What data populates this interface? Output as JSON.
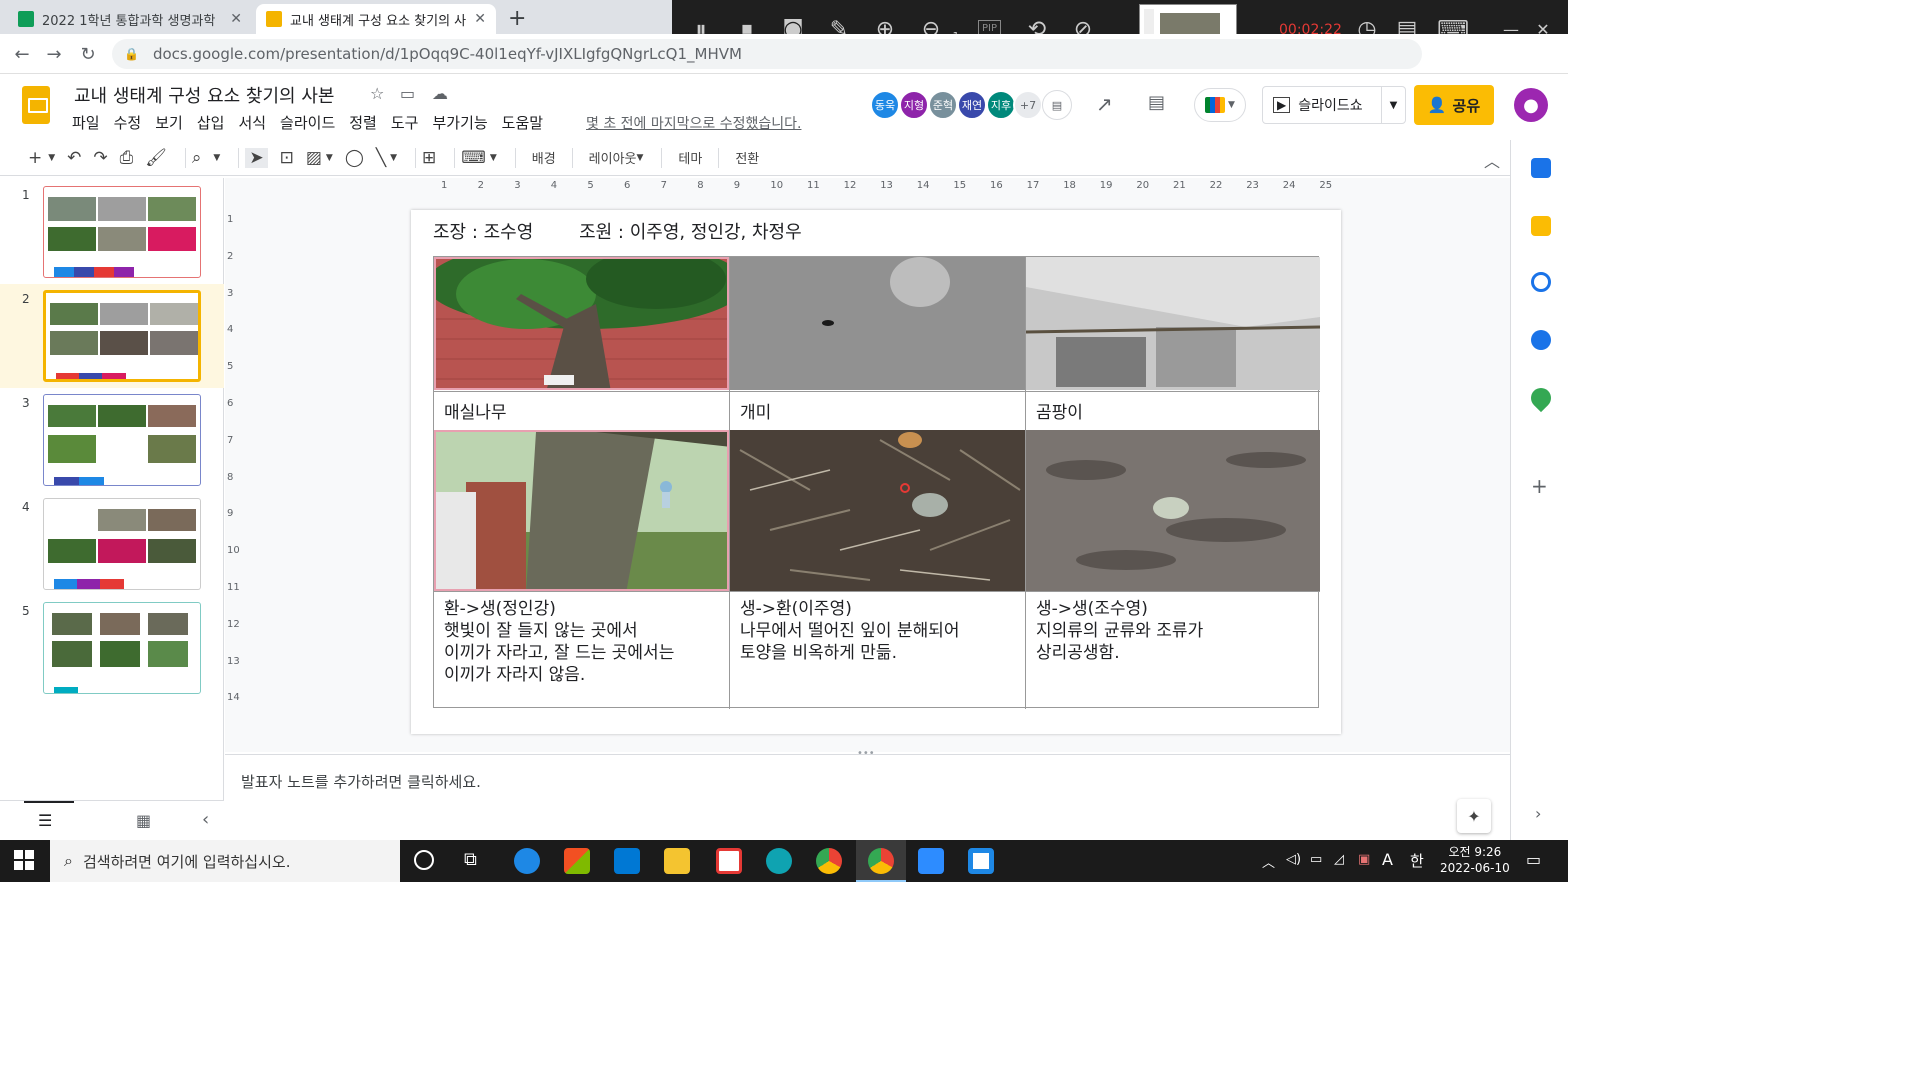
{
  "browser": {
    "tabs": [
      {
        "title": "2022 1학년 통합과학 생명과학",
        "favicon_color": "#0f9d58"
      },
      {
        "title": "교내 생태계 구성 요소 찾기의 사",
        "favicon_color": "#f4b400"
      }
    ],
    "url": "docs.google.com/presentation/d/1pOqq9C-40l1eqYf-vJIXLIgfgQNgrLcQ1_MHVM"
  },
  "recorder": {
    "time": "00:02:22",
    "zoom": "x1",
    "pip_label": "PIP"
  },
  "doc": {
    "title": "교내 생태계 구성 요소 찾기의 사본",
    "menu": [
      "파일",
      "수정",
      "보기",
      "삽입",
      "서식",
      "슬라이드",
      "정렬",
      "도구",
      "부가기능",
      "도움말"
    ],
    "last_edit": "몇 초 전에 마지막으로 수정했습니다.",
    "collaborators": [
      {
        "name": "동욱",
        "color": "#1e88e5"
      },
      {
        "name": "지형",
        "color": "#8e24aa"
      },
      {
        "name": "준혁",
        "color": "#78909c"
      },
      {
        "name": "재연",
        "color": "#3949ab"
      },
      {
        "name": "지후",
        "color": "#00897b"
      }
    ],
    "more_collaborators": "+7",
    "slideshow_label": "슬라이드쇼",
    "share_label": "공유"
  },
  "toolbar": {
    "background": "배경",
    "layout": "레이아웃",
    "theme": "테마",
    "transition": "전환"
  },
  "filmstrip": {
    "slides": [
      "1",
      "2",
      "3",
      "4",
      "5"
    ],
    "selected": 2
  },
  "slide": {
    "team_line": "조장 : 조수영        조원 : 이주영, 정인강, 차정우",
    "labels": [
      "매실나무",
      "개미",
      "곰팡이"
    ],
    "descriptions": [
      "환->생(정인강)\n햇빛이 잘 들지 않는 곳에서\n이끼가 자라고, 잘 드는 곳에서는\n이끼가 자라지 않음.",
      "생->환(이주영)\n나무에서 떨어진 잎이 분해되어\n토양을 비옥하게 만듦.",
      "생->생(조수영)\n지의류의 균류와 조류가\n상리공생함."
    ]
  },
  "ruler": {
    "h_ticks": [
      "1",
      "2",
      "3",
      "4",
      "5",
      "6",
      "7",
      "8",
      "9",
      "10",
      "11",
      "12",
      "13",
      "14",
      "15",
      "16",
      "17",
      "18",
      "19",
      "20",
      "21",
      "22",
      "23",
      "24",
      "25"
    ],
    "v_ticks": [
      "1",
      "2",
      "3",
      "4",
      "5",
      "6",
      "7",
      "8",
      "9",
      "10",
      "11",
      "12",
      "13",
      "14"
    ]
  },
  "notes": {
    "placeholder": "발표자 노트를 추가하려면 클릭하세요."
  },
  "taskbar": {
    "search_placeholder": "검색하려면 여기에 입력하십시오.",
    "time": "오전 9:26",
    "date": "2022-06-10",
    "ime": "한",
    "ime_mode": "A"
  }
}
